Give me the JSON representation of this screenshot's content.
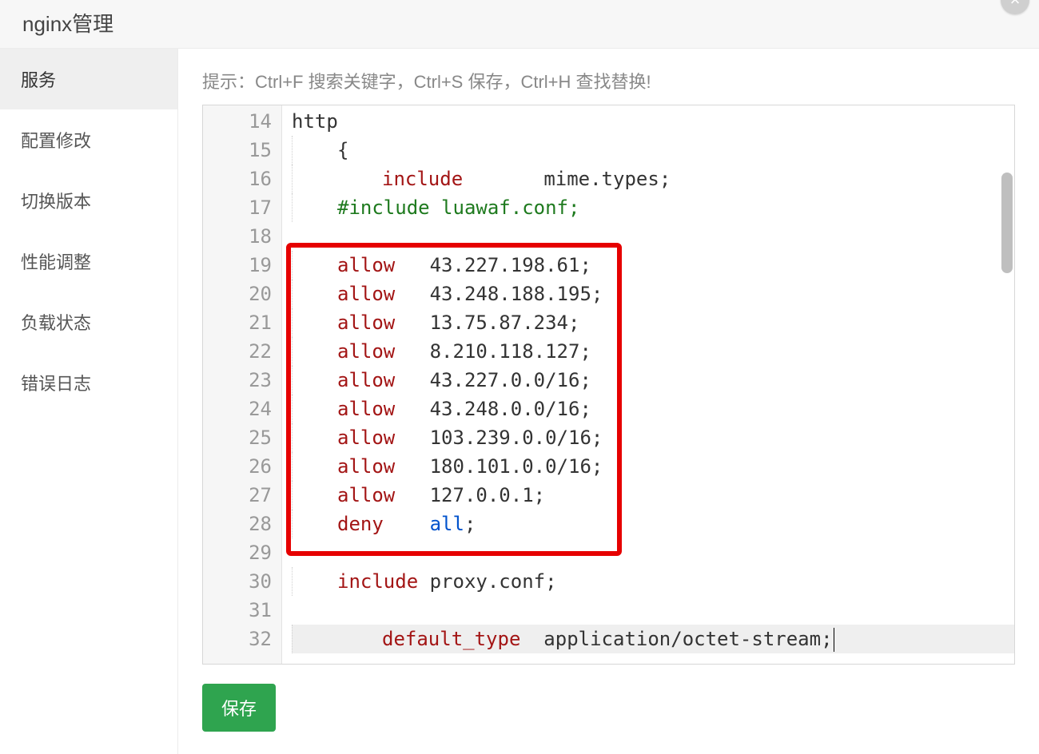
{
  "window": {
    "title": "nginx管理",
    "close_label": "×"
  },
  "sidebar": {
    "items": [
      {
        "label": "服务",
        "active": true
      },
      {
        "label": "配置修改",
        "active": false
      },
      {
        "label": "切换版本",
        "active": false
      },
      {
        "label": "性能调整",
        "active": false
      },
      {
        "label": "负载状态",
        "active": false
      },
      {
        "label": "错误日志",
        "active": false
      }
    ]
  },
  "main": {
    "hint": "提示：Ctrl+F 搜索关键字，Ctrl+S 保存，Ctrl+H 查找替换!",
    "save_label": "保存"
  },
  "editor": {
    "first_line_no": 14,
    "cursor_line": 32,
    "highlight": {
      "from": 19,
      "to": 28
    },
    "lines": [
      {
        "n": 14,
        "tokens": [
          {
            "t": "http",
            "c": "val"
          }
        ]
      },
      {
        "n": 15,
        "indent": 1,
        "tokens": [
          {
            "t": "{",
            "c": "val"
          }
        ]
      },
      {
        "n": 16,
        "indent": 2,
        "tokens": [
          {
            "t": "include",
            "c": "kw"
          },
          {
            "t": "       ",
            "c": "val"
          },
          {
            "t": "mime.types",
            "c": "val"
          },
          {
            "t": ";",
            "c": "val"
          }
        ]
      },
      {
        "n": 17,
        "indent": 1,
        "tokens": [
          {
            "t": "#include luawaf.conf;",
            "c": "kw2"
          }
        ]
      },
      {
        "n": 18,
        "tokens": []
      },
      {
        "n": 19,
        "indent": 1,
        "tokens": [
          {
            "t": "allow",
            "c": "kw"
          },
          {
            "t": "   ",
            "c": "val"
          },
          {
            "t": "43.227.198.61",
            "c": "val"
          },
          {
            "t": ";",
            "c": "val"
          }
        ]
      },
      {
        "n": 20,
        "indent": 1,
        "tokens": [
          {
            "t": "allow",
            "c": "kw"
          },
          {
            "t": "   ",
            "c": "val"
          },
          {
            "t": "43.248.188.195",
            "c": "val"
          },
          {
            "t": ";",
            "c": "val"
          }
        ]
      },
      {
        "n": 21,
        "indent": 1,
        "tokens": [
          {
            "t": "allow",
            "c": "kw"
          },
          {
            "t": "   ",
            "c": "val"
          },
          {
            "t": "13.75.87.234",
            "c": "val"
          },
          {
            "t": ";",
            "c": "val"
          }
        ]
      },
      {
        "n": 22,
        "indent": 1,
        "tokens": [
          {
            "t": "allow",
            "c": "kw"
          },
          {
            "t": "   ",
            "c": "val"
          },
          {
            "t": "8.210.118.127",
            "c": "val"
          },
          {
            "t": ";",
            "c": "val"
          }
        ]
      },
      {
        "n": 23,
        "indent": 1,
        "tokens": [
          {
            "t": "allow",
            "c": "kw"
          },
          {
            "t": "   ",
            "c": "val"
          },
          {
            "t": "43.227.0.0/16",
            "c": "val"
          },
          {
            "t": ";",
            "c": "val"
          }
        ]
      },
      {
        "n": 24,
        "indent": 1,
        "tokens": [
          {
            "t": "allow",
            "c": "kw"
          },
          {
            "t": "   ",
            "c": "val"
          },
          {
            "t": "43.248.0.0/16",
            "c": "val"
          },
          {
            "t": ";",
            "c": "val"
          }
        ]
      },
      {
        "n": 25,
        "indent": 1,
        "tokens": [
          {
            "t": "allow",
            "c": "kw"
          },
          {
            "t": "   ",
            "c": "val"
          },
          {
            "t": "103.239.0.0/16",
            "c": "val"
          },
          {
            "t": ";",
            "c": "val"
          }
        ]
      },
      {
        "n": 26,
        "indent": 1,
        "tokens": [
          {
            "t": "allow",
            "c": "kw"
          },
          {
            "t": "   ",
            "c": "val"
          },
          {
            "t": "180.101.0.0/16",
            "c": "val"
          },
          {
            "t": ";",
            "c": "val"
          }
        ]
      },
      {
        "n": 27,
        "indent": 1,
        "tokens": [
          {
            "t": "allow",
            "c": "kw"
          },
          {
            "t": "   ",
            "c": "val"
          },
          {
            "t": "127.0.0.1",
            "c": "val"
          },
          {
            "t": ";",
            "c": "val"
          }
        ]
      },
      {
        "n": 28,
        "indent": 1,
        "tokens": [
          {
            "t": "deny",
            "c": "kw"
          },
          {
            "t": "    ",
            "c": "val"
          },
          {
            "t": "all",
            "c": "valblue"
          },
          {
            "t": ";",
            "c": "val"
          }
        ]
      },
      {
        "n": 29,
        "tokens": []
      },
      {
        "n": 30,
        "indent": 1,
        "tokens": [
          {
            "t": "include",
            "c": "kw"
          },
          {
            "t": " ",
            "c": "val"
          },
          {
            "t": "proxy.conf",
            "c": "val"
          },
          {
            "t": ";",
            "c": "val"
          }
        ]
      },
      {
        "n": 31,
        "tokens": []
      },
      {
        "n": 32,
        "indent": 2,
        "tokens": [
          {
            "t": "default_type",
            "c": "kw"
          },
          {
            "t": "  ",
            "c": "val"
          },
          {
            "t": "application/octet-stream",
            "c": "val"
          },
          {
            "t": ";",
            "c": "val"
          }
        ],
        "cursor_after": true
      }
    ],
    "scroll": {
      "thumb_top_pct": 12,
      "thumb_height_pct": 18
    }
  }
}
